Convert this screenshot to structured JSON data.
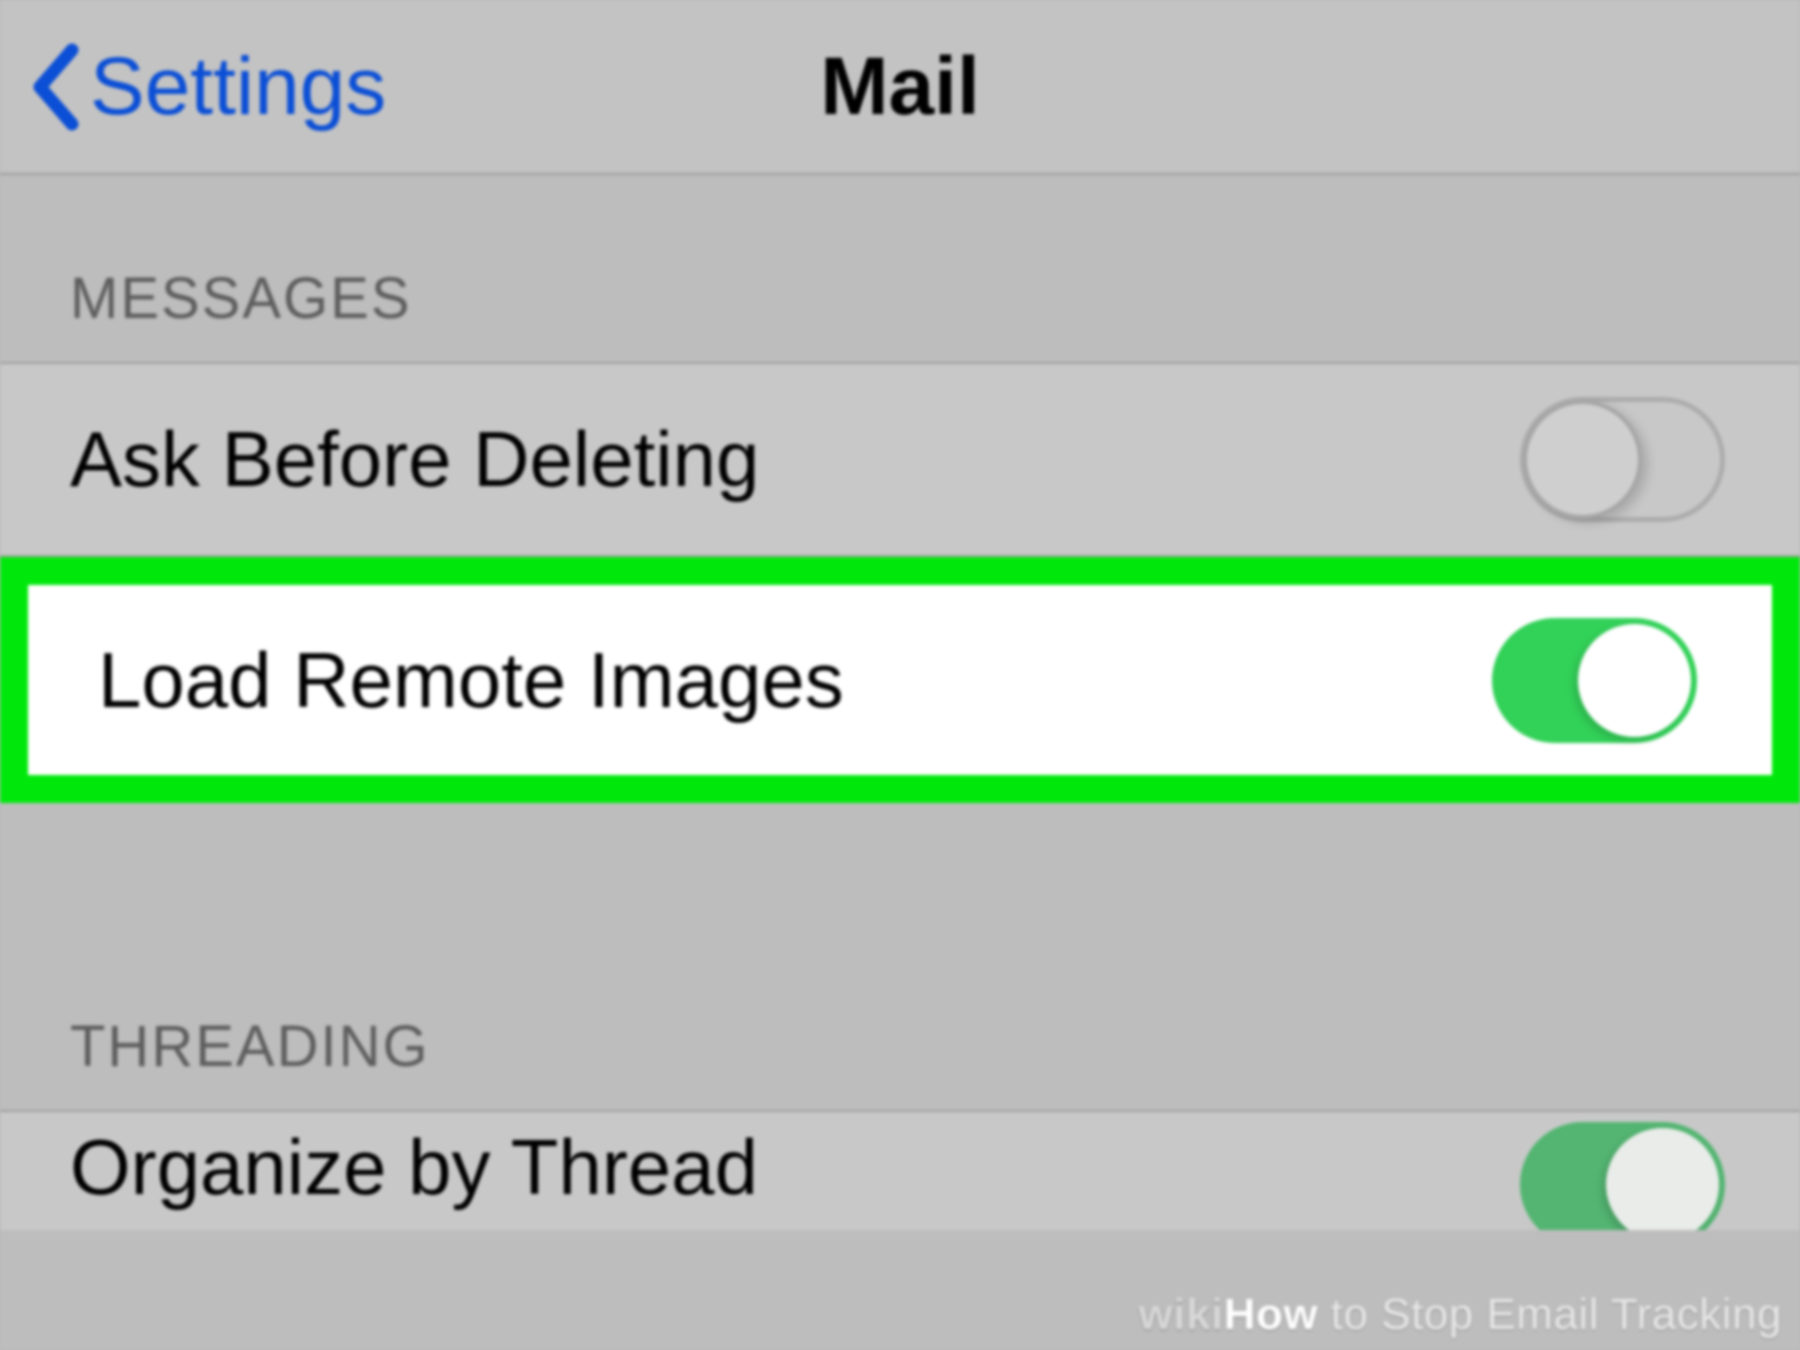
{
  "navbar": {
    "back_label": "Settings",
    "title": "Mail"
  },
  "sections": {
    "messages_header": "MESSAGES",
    "threading_header": "THREADING"
  },
  "rows": {
    "ask_before_deleting": {
      "label": "Ask Before Deleting",
      "on": false
    },
    "load_remote_images": {
      "label": "Load Remote Images",
      "on": true
    },
    "organize_by_thread": {
      "label": "Organize by Thread",
      "on": true
    }
  },
  "watermark": {
    "wiki": "wiki",
    "how": "How",
    "rest": " to Stop Email Tracking"
  },
  "colors": {
    "accent_blue": "#0b4fd6",
    "highlight_green": "#00e80b",
    "toggle_on": "#32d158"
  }
}
